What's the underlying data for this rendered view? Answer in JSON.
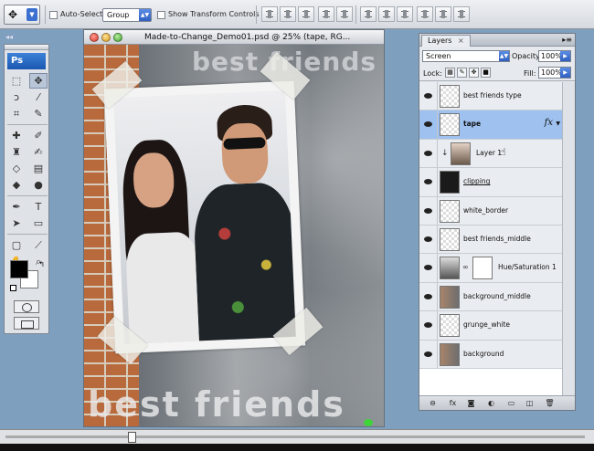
{
  "options_bar": {
    "tool_preset_icon": "move-tool-icon",
    "auto_select_label": "Auto-Select:",
    "auto_select_value": "Group",
    "show_transform_label": "Show Transform Controls"
  },
  "toolbox": {
    "logo": "Ps"
  },
  "document": {
    "title": "Made-to-Change_Demo01.psd @ 25% (tape, RG...",
    "canvas_text_top": "best friends",
    "canvas_text_bottom": "best friends"
  },
  "layers_panel": {
    "tab_label": "Layers",
    "tab_close": "×",
    "blend_mode": "Screen",
    "opacity_label": "Opacity:",
    "opacity_value": "100%",
    "lock_label": "Lock:",
    "fill_label": "Fill:",
    "fill_value": "100%",
    "layers": [
      {
        "name": "best friends type",
        "selected": false
      },
      {
        "name": "tape",
        "selected": true,
        "fx": "fx"
      },
      {
        "name": "Layer 1",
        "selected": false,
        "clipped": true
      },
      {
        "name": "clipping",
        "selected": false
      },
      {
        "name": "white_border",
        "selected": false
      },
      {
        "name": "best friends_middle",
        "selected": false
      },
      {
        "name": "Hue/Saturation 1",
        "selected": false
      },
      {
        "name": "background_middle",
        "selected": false
      },
      {
        "name": "grunge_white",
        "selected": false
      },
      {
        "name": "background",
        "selected": false
      }
    ]
  },
  "colors": {
    "selection_blue": "#9ec1f0",
    "accent_blue": "#2f5fc0",
    "app_bg": "#7f9fbf"
  }
}
